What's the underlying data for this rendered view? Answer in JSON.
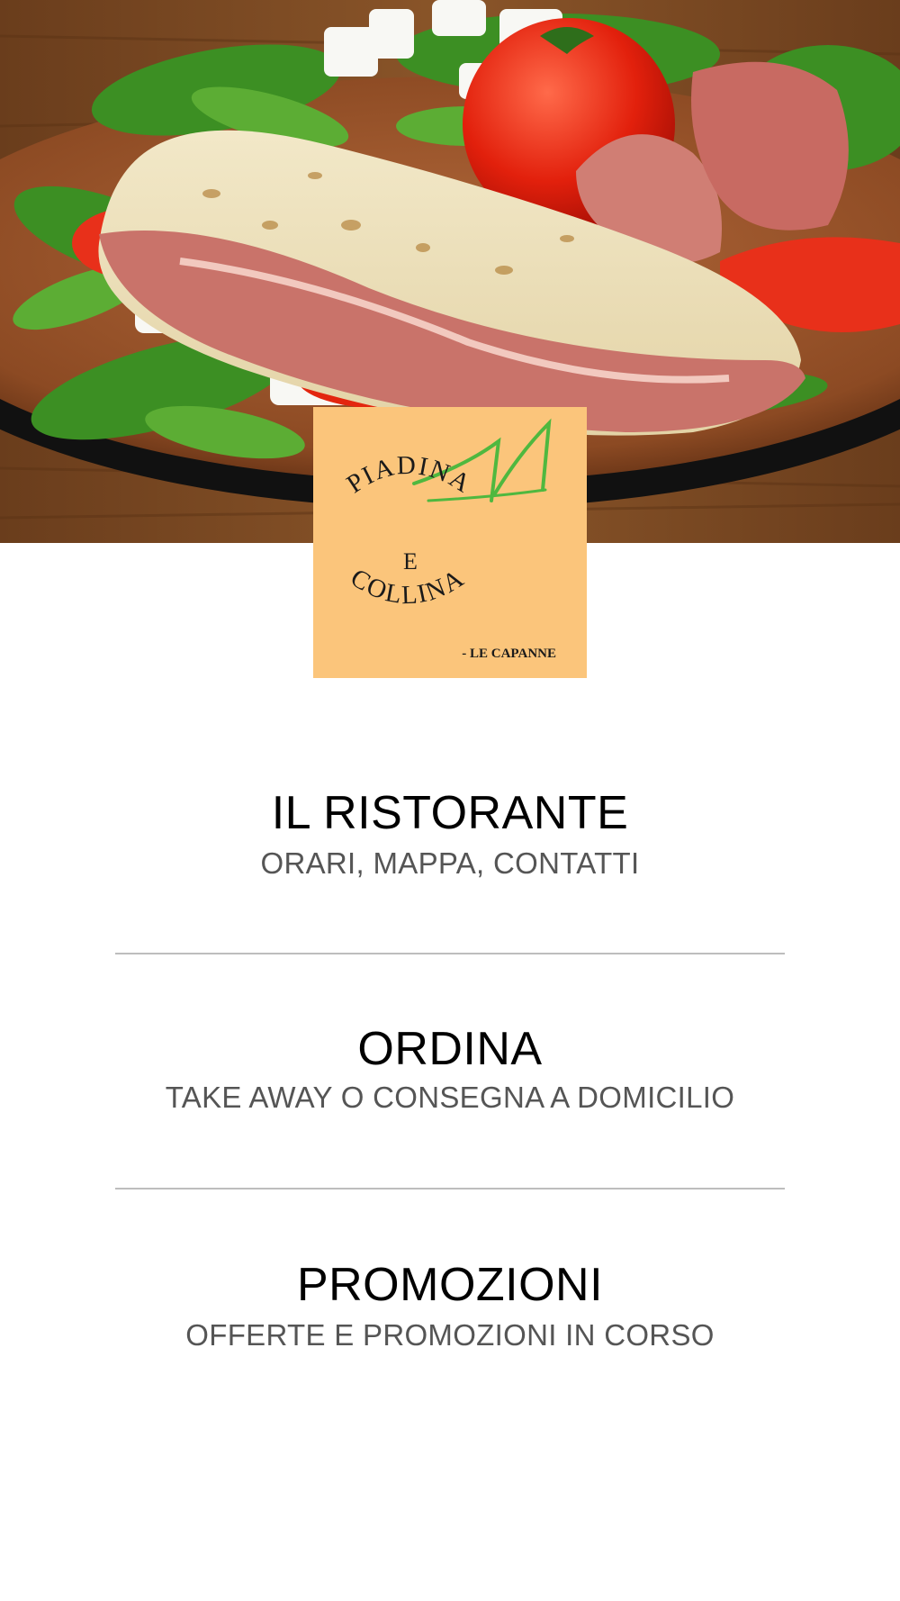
{
  "hero": {
    "image_icon": "food-photo-piadina-prosciutto"
  },
  "logo": {
    "line1": "PIADINA",
    "line2": "E",
    "line3": "COLLINA",
    "tagline": "- LE CAPANNE",
    "background_color": "#fbc57b",
    "accent_color": "#4fb83f"
  },
  "menu": {
    "items": [
      {
        "title": "IL RISTORANTE",
        "subtitle": "ORARI, MAPPA, CONTATTI"
      },
      {
        "title": "ORDINA",
        "subtitle": "TAKE AWAY O CONSEGNA A DOMICILIO"
      },
      {
        "title": "PROMOZIONI",
        "subtitle": "OFFERTE E PROMOZIONI IN CORSO"
      }
    ]
  },
  "colors": {
    "title": "#000000",
    "subtitle": "#555555",
    "divider": "#bdbdbd"
  }
}
